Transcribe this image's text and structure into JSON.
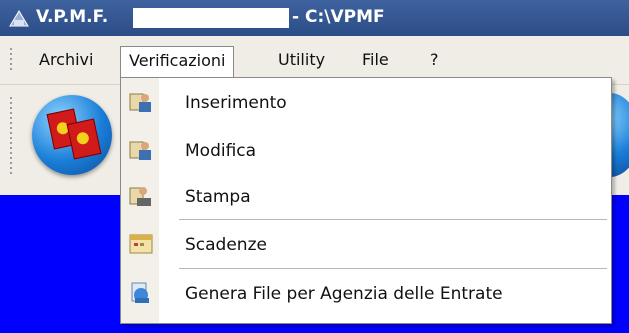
{
  "window": {
    "title_prefix": "V.P.M.F.",
    "title_suffix": "- C:\\VPMF"
  },
  "menubar": {
    "items": [
      {
        "label": "Archivi"
      },
      {
        "label": "Verificazioni"
      },
      {
        "label": "Utility"
      },
      {
        "label": "File"
      },
      {
        "label": "?"
      }
    ]
  },
  "dropdown": {
    "items": [
      {
        "label": "Inserimento",
        "icon": "user-add-icon"
      },
      {
        "label": "Modifica",
        "icon": "user-edit-icon"
      },
      {
        "label": "Stampa",
        "icon": "user-print-icon"
      },
      {
        "label": "Scadenze",
        "icon": "calendar-icon"
      },
      {
        "label": "Genera File per Agenzia delle Entrate",
        "icon": "export-file-icon"
      }
    ]
  },
  "colors": {
    "titlebar": "#2b4c86",
    "workspace": "#0000ff",
    "menubar": "#efede5"
  }
}
